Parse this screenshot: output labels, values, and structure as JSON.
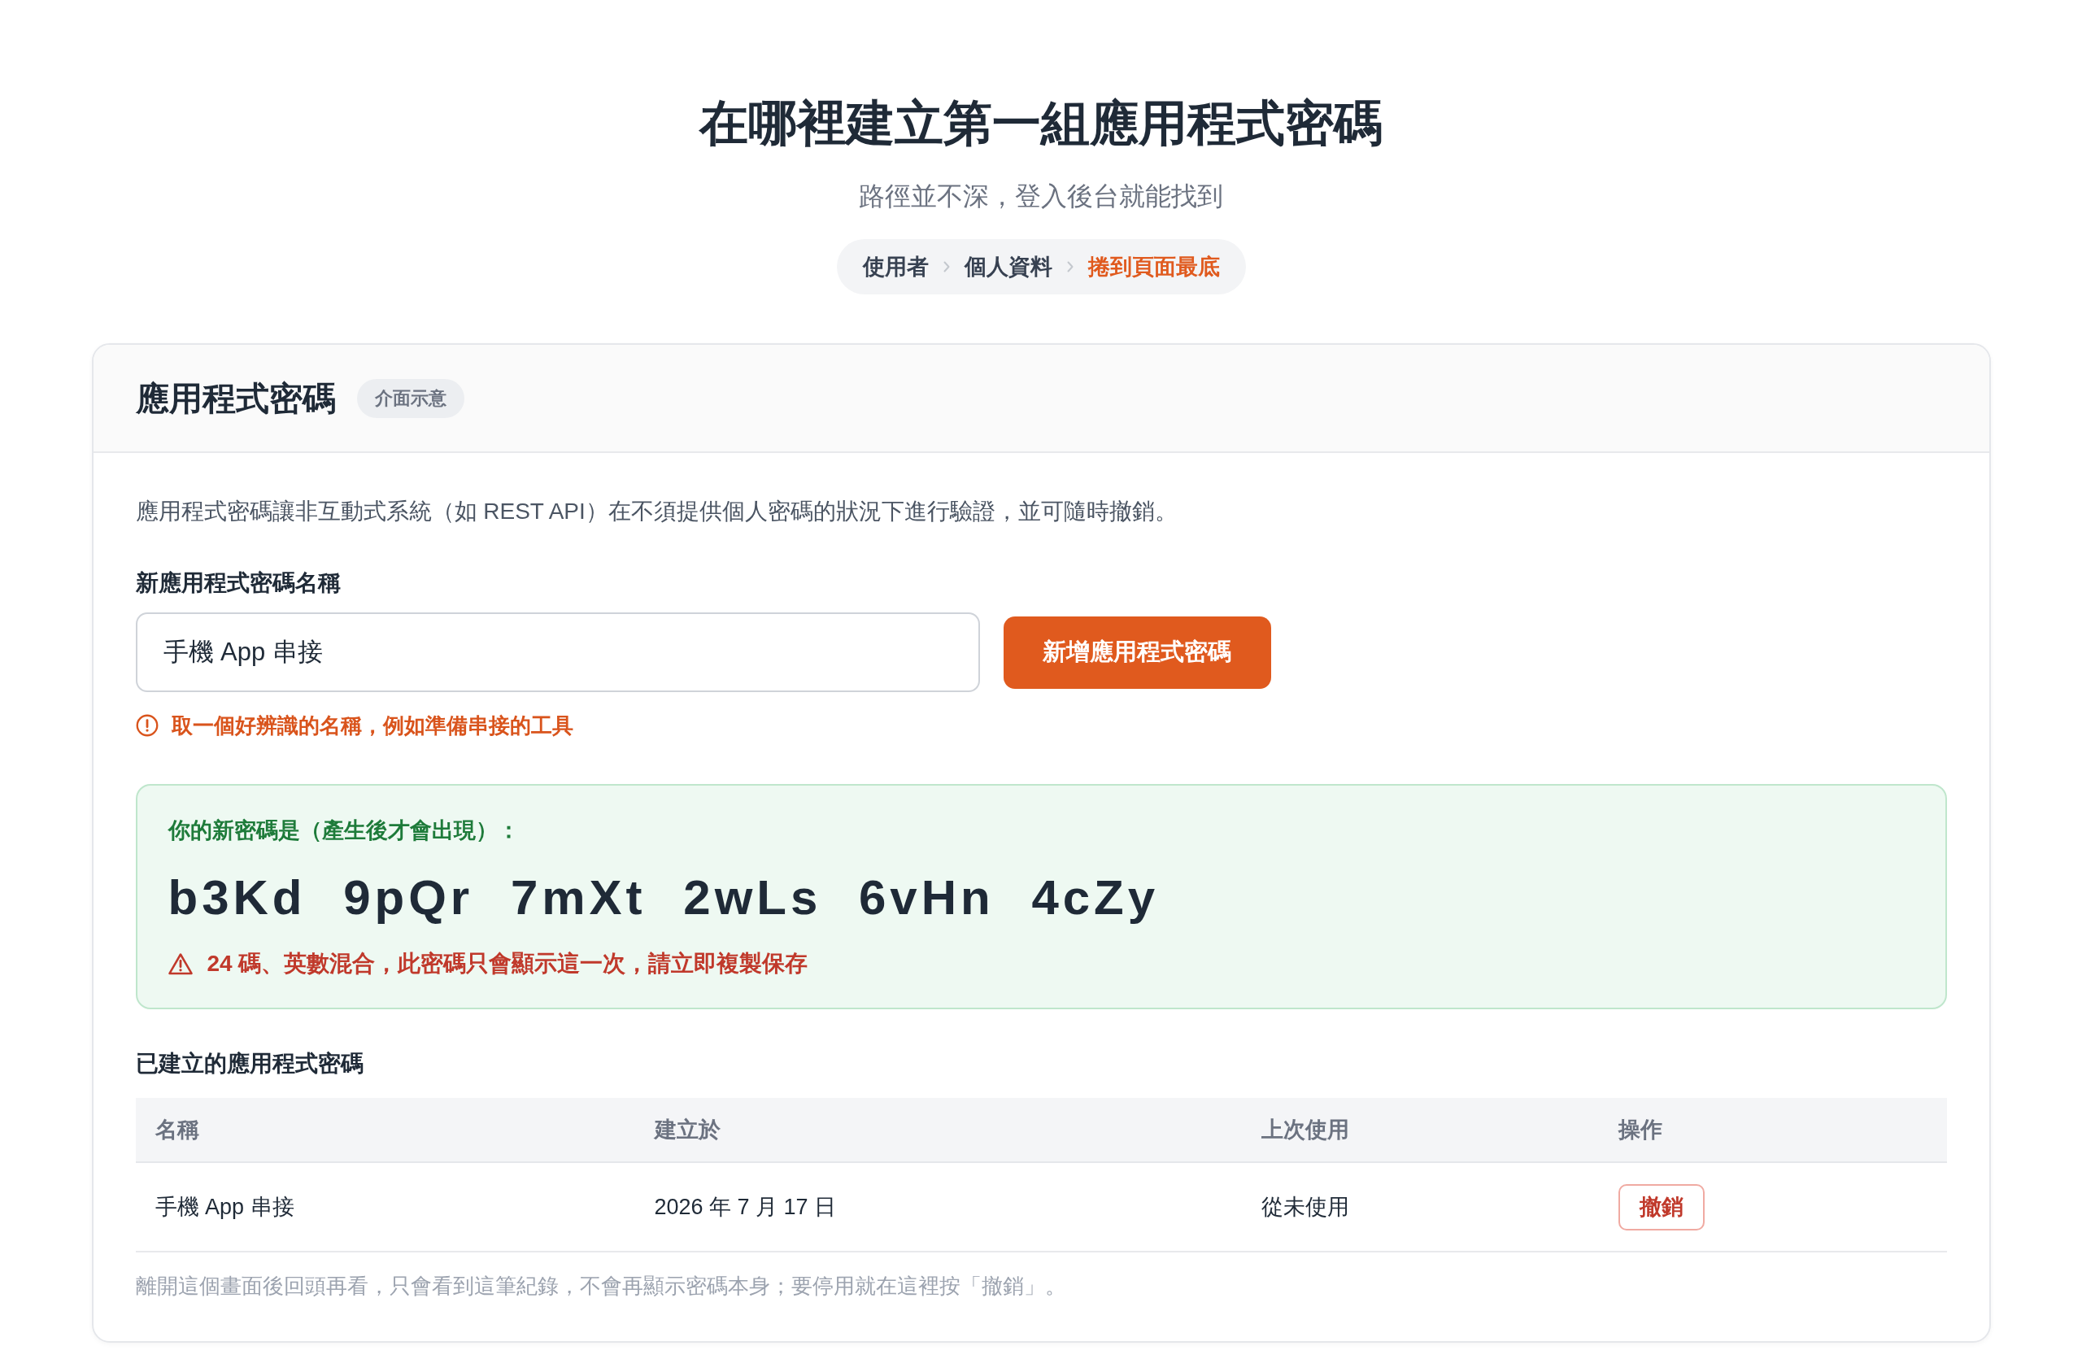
{
  "page": {
    "title": "在哪裡建立第一組應用程式密碼",
    "subtitle": "路徑並不深，登入後台就能找到"
  },
  "breadcrumb": [
    {
      "label": "使用者",
      "current": false
    },
    {
      "label": "個人資料",
      "current": false
    },
    {
      "label": "捲到頁面最底",
      "current": true
    }
  ],
  "card": {
    "title": "應用程式密碼",
    "badge": "介面示意",
    "description": "應用程式密碼讓非互動式系統（如 REST API）在不須提供個人密碼的狀況下進行驗證，並可隨時撤銷。",
    "field_label": "新應用程式密碼名稱",
    "name_field": {
      "value": "手機 App 串接"
    },
    "add_button": "新增應用程式密碼",
    "hint": "取一個好辨識的名稱，例如準備串接的工具",
    "new_password": {
      "label": "你的新密碼是（產生後才會出現）：",
      "value": "b3Kd 9pQr 7mXt 2wLs 6vHn 4cZy",
      "warning": "24 碼、英數混合，此密碼只會顯示這一次，請立即複製保存"
    },
    "existing": {
      "title": "已建立的應用程式密碼",
      "columns": [
        "名稱",
        "建立於",
        "上次使用",
        "操作"
      ],
      "rows": [
        {
          "name": "手機 App 串接",
          "created": "2026 年 7 月 17 日",
          "last_used": "從未使用",
          "action": "撤銷"
        }
      ]
    },
    "footnote": "離開這個畫面後回頭再看，只會看到這筆紀錄，不會再顯示密碼本身；要停用就在這裡按「撤銷」。"
  }
}
